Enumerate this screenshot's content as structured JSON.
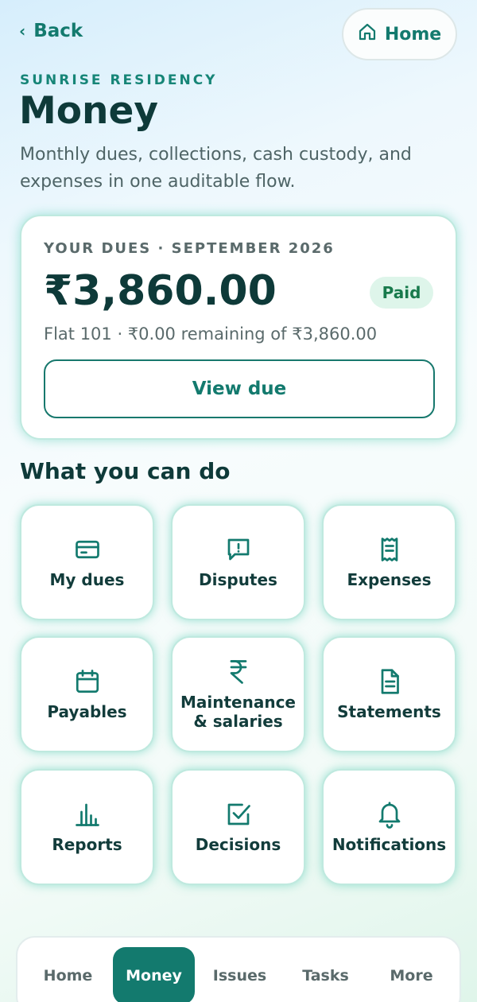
{
  "header": {
    "back_label": "Back",
    "home_label": "Home"
  },
  "page": {
    "eyebrow": "SUNRISE RESIDENCY",
    "title": "Money",
    "subtitle": "Monthly dues, collections, cash custody, and expenses in one auditable flow."
  },
  "dues": {
    "label": "YOUR DUES · SEPTEMBER 2026",
    "amount": "₹3,860.00",
    "status": "Paid",
    "meta": "Flat 101 · ₹0.00 remaining of ₹3,860.00",
    "button": "View due"
  },
  "actions": {
    "title": "What you can do",
    "tiles": [
      {
        "label": "My dues",
        "icon": "card-icon"
      },
      {
        "label": "Disputes",
        "icon": "message-alert-icon"
      },
      {
        "label": "Expenses",
        "icon": "receipt-icon"
      },
      {
        "label": "Payables",
        "icon": "calendar-icon"
      },
      {
        "label": "Maintenance & salaries",
        "icon": "rupee-icon"
      },
      {
        "label": "Statements",
        "icon": "document-icon"
      },
      {
        "label": "Reports",
        "icon": "bar-chart-icon"
      },
      {
        "label": "Decisions",
        "icon": "checkbox-icon"
      },
      {
        "label": "Notifications",
        "icon": "bell-icon"
      }
    ]
  },
  "nav": {
    "items": [
      "Home",
      "Money",
      "Issues",
      "Tasks",
      "More"
    ],
    "active": "Money"
  },
  "colors": {
    "accent": "#137a6e",
    "title": "#0e3a39",
    "paid_badge_bg": "#def5ea",
    "paid_badge_text": "#187a4c"
  }
}
